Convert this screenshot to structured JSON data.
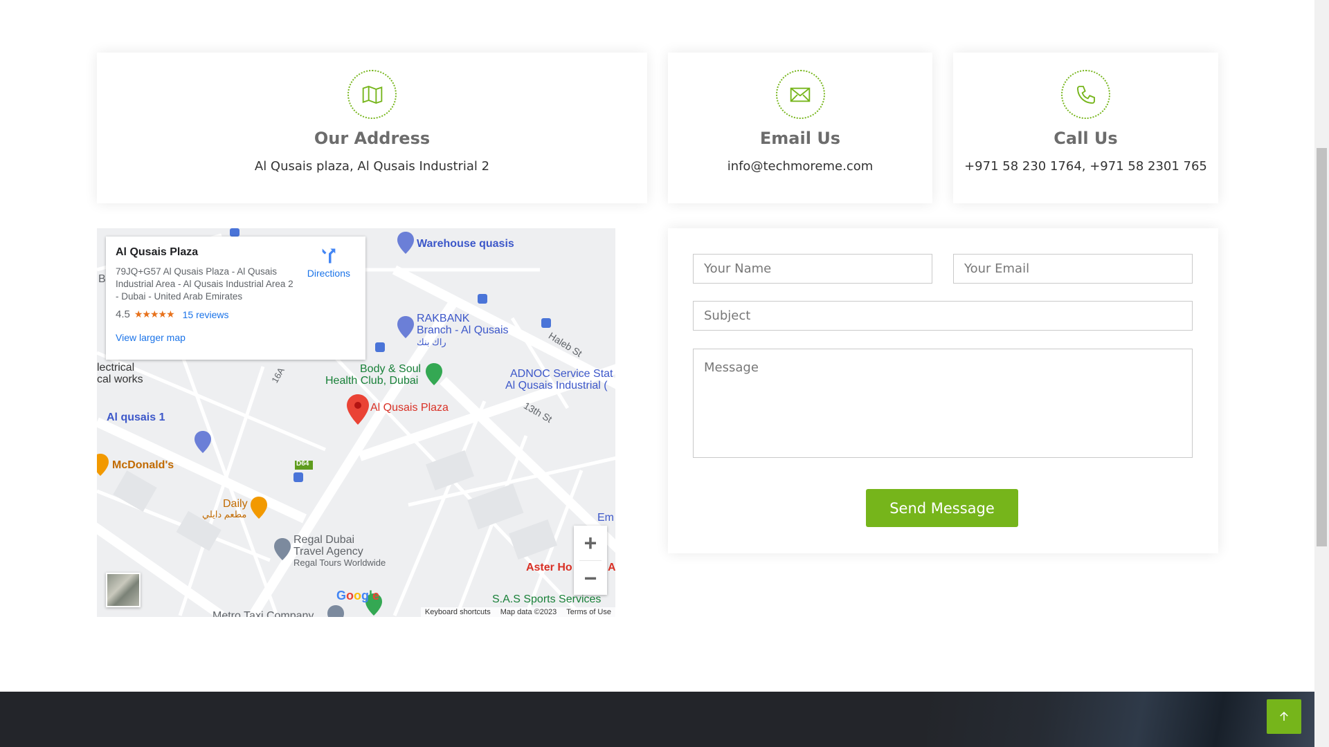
{
  "cards": {
    "address": {
      "title": "Our Address",
      "text": "Al Qusais plaza, Al Qusais Industrial 2"
    },
    "email": {
      "title": "Email Us",
      "text": "info@techmoreme.com"
    },
    "phone": {
      "title": "Call Us",
      "text": "+971 58 230 1764, +971 58 2301 765"
    }
  },
  "map": {
    "place_name": "Al Qusais Plaza",
    "address": "79JQ+G57 Al Qusais Plaza - Al Qusais Industrial Area - Al Qusais Industrial Area 2 - Dubai - United Arab Emirates",
    "rating": "4.5",
    "stars": "★★★★★",
    "reviews": "15 reviews",
    "directions": "Directions",
    "view_larger": "View larger map",
    "labels": {
      "warehouse": "Warehouse quasis",
      "rakbank_1": "RAKBANK",
      "rakbank_2": "Branch - Al Qusais",
      "rakbank_ar": "راك بنك",
      "haleb": "Haleb St",
      "electrical_1": "lectrical",
      "electrical_2": "cal works",
      "body_soul_1": "Body & Soul",
      "body_soul_2": "Health Club, Dubai",
      "adnoc_1": "ADNOC Service Stat",
      "adnoc_2": "Al Qusais Industrial (",
      "pin": "Al Qusais Plaza",
      "st13": "13th St",
      "alqusais1": "Al qusais 1",
      "mcdonalds": "McDonald's",
      "d64": "D64",
      "daily": "Daily",
      "daily_ar": "مطعم دايلي",
      "regal_1": "Regal Dubai",
      "regal_2": "Travel Agency",
      "regal_3": "Regal Tours Worldwide",
      "em": "Em",
      "aster": "Aster Ho",
      "aster_a": "A",
      "sas": "S.A.S Sports Services",
      "metro": "Metro Taxi Company",
      "st16a": "16A",
      "b_edge": "B"
    },
    "google": "Google",
    "footer": {
      "shortcuts": "Keyboard shortcuts",
      "mapdata": "Map data ©2023",
      "terms": "Terms of Use"
    },
    "zoom_in": "+",
    "zoom_out": "−"
  },
  "form": {
    "name_placeholder": "Your Name",
    "email_placeholder": "Your Email",
    "subject_placeholder": "Subject",
    "message_placeholder": "Message",
    "submit": "Send Message"
  },
  "colors": {
    "accent": "#76b51b",
    "footer": "#23252a"
  }
}
